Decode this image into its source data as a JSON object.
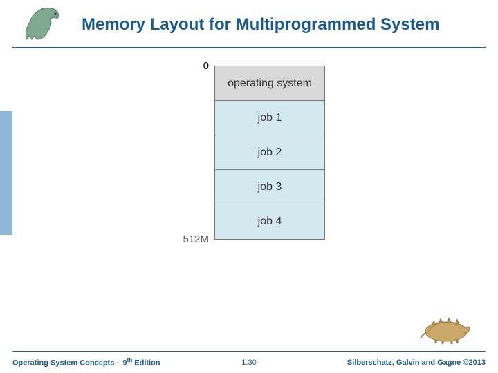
{
  "title": "Memory Layout for Multiprogrammed System",
  "memory": {
    "top_address": "0",
    "bottom_address": "512M",
    "segments": [
      {
        "label": "operating system",
        "kind": "os"
      },
      {
        "label": "job 1",
        "kind": "job"
      },
      {
        "label": "job 2",
        "kind": "job"
      },
      {
        "label": "job 3",
        "kind": "job"
      },
      {
        "label": "job 4",
        "kind": "job"
      }
    ]
  },
  "footer": {
    "book_prefix": "Operating System Concepts – 9",
    "book_sup": "th",
    "book_suffix": " Edition",
    "page": "1.30",
    "copyright": "Silberschatz, Galvin and Gagne ©2013"
  },
  "icons": {
    "dino_left": "dinosaur-icon",
    "dino_right": "ankylosaur-icon"
  }
}
